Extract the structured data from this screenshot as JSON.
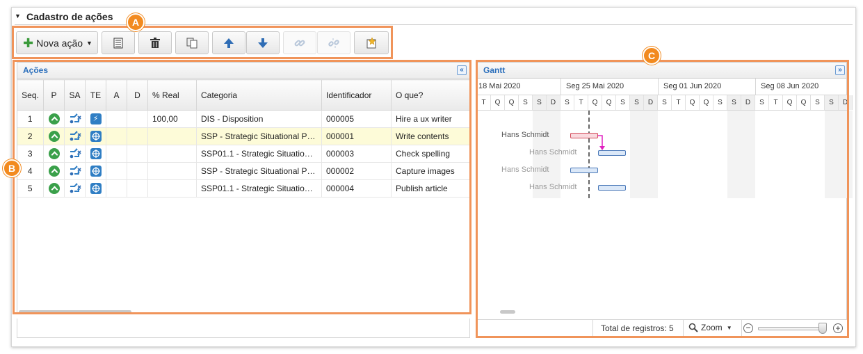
{
  "section": {
    "title": "Cadastro de ações"
  },
  "toolbar": {
    "new_action_label": "Nova ação",
    "buttons": [
      "details-icon",
      "trash-icon",
      "copy-icon",
      "arrow-up-icon",
      "arrow-down-icon",
      "link-icon",
      "unlink-icon",
      "new-item-icon"
    ]
  },
  "callouts": {
    "a": "A",
    "b": "B",
    "c": "C"
  },
  "acoes": {
    "title": "Ações",
    "columns": [
      "Seq.",
      "P",
      "SA",
      "TE",
      "A",
      "D",
      "% Real",
      "Categoria",
      "Identificador",
      "O que?"
    ],
    "rows": [
      {
        "seq": "1",
        "real": "100,00",
        "categoria": "DIS - Disposition",
        "identificador": "000005",
        "oque": "Hire a ux writer",
        "te": "lightning-icon"
      },
      {
        "seq": "2",
        "real": "",
        "categoria": "SSP - Strategic Situational Planning",
        "identificador": "000001",
        "oque": "Write contents",
        "te": "target-icon"
      },
      {
        "seq": "3",
        "real": "",
        "categoria": "SSP01.1 - Strategic Situational Planning",
        "identificador": "000003",
        "oque": "Check spelling",
        "te": "target-icon"
      },
      {
        "seq": "4",
        "real": "",
        "categoria": "SSP - Strategic Situational Planning",
        "identificador": "000002",
        "oque": "Capture images",
        "te": "target-icon"
      },
      {
        "seq": "5",
        "real": "",
        "categoria": "SSP01.1 - Strategic Situational Planning",
        "identificador": "000004",
        "oque": "Publish article",
        "te": "target-icon"
      }
    ]
  },
  "gantt": {
    "title": "Gantt",
    "weeks": [
      "18 Mai 2020",
      "Seg 25 Mai 2020",
      "Seg 01 Jun 2020",
      "Seg 08 Jun 2020"
    ],
    "days": [
      "T",
      "Q",
      "Q",
      "S",
      "S",
      "D",
      "S",
      "T",
      "Q",
      "Q",
      "S",
      "S",
      "D",
      "S",
      "T",
      "Q",
      "Q",
      "S",
      "S",
      "D",
      "S",
      "T",
      "Q",
      "Q",
      "S",
      "S",
      "D"
    ],
    "resources": [
      "Hans Schmidt",
      "Hans Schmidt",
      "Hans Schmidt",
      "Hans Schmidt"
    ]
  },
  "footer": {
    "total_label": "Total de registros: 5",
    "zoom_label": "Zoom"
  },
  "colors": {
    "accent": "#2a6ebb",
    "callout": "#f28a1f",
    "selected_row": "#fdfbd8",
    "weekend": "#f2f2f2"
  }
}
